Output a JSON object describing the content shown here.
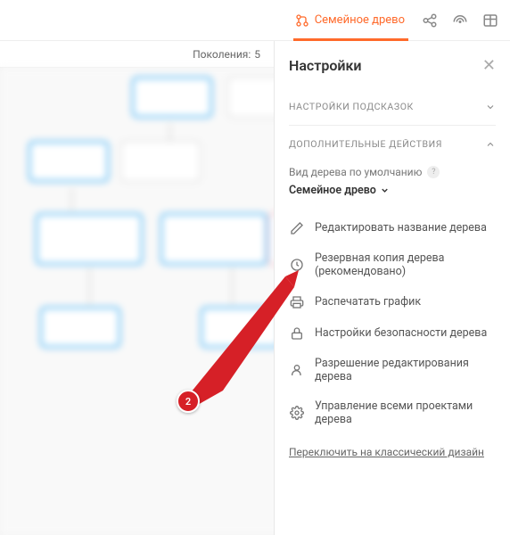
{
  "topbar": {
    "active_tab": "Семейное древо"
  },
  "info": {
    "generations_label": "Поколения:",
    "generations_value": "5"
  },
  "panel": {
    "title": "Настройки",
    "sections": {
      "hints": "НАСТРОЙКИ ПОДСКАЗОК",
      "additional": "ДОПОЛНИТЕЛЬНЫЕ ДЕЙСТВИЯ"
    },
    "default_tree_label": "Вид дерева по умолчанию",
    "default_tree_value": "Семейное древо",
    "actions": [
      {
        "icon": "pencil",
        "label": "Редактировать название дерева"
      },
      {
        "icon": "clock",
        "label": "Резервная копия дерева (рекомендовано)"
      },
      {
        "icon": "print",
        "label": "Распечатать график"
      },
      {
        "icon": "lock",
        "label": "Настройки безопасности дерева"
      },
      {
        "icon": "person",
        "label": "Разрешение редактирования дерева"
      },
      {
        "icon": "gear",
        "label": "Управление всеми проектами дерева"
      }
    ],
    "classic_link": "Переключить на классический дизайн"
  },
  "annotation": {
    "badge": "2"
  }
}
